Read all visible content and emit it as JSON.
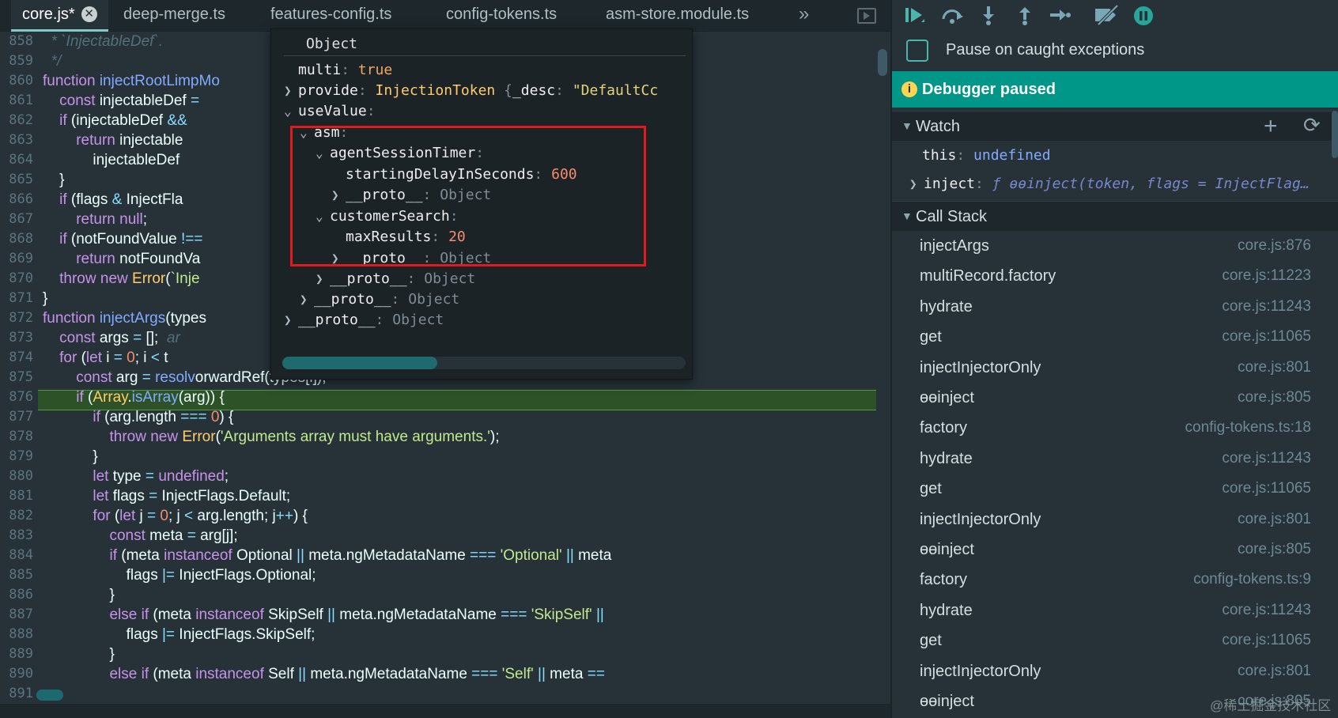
{
  "tabs": [
    {
      "label": "core.js*",
      "close": "✕"
    },
    {
      "label": "deep-merge.ts"
    },
    {
      "label": "features-config.ts"
    },
    {
      "label": "config-tokens.ts"
    },
    {
      "label": "asm-store.module.ts"
    }
  ],
  "tab_overflow": "»",
  "line_numbers": [
    "858",
    "859",
    "860",
    "861",
    "862",
    "863",
    "864",
    "865",
    "866",
    "867",
    "868",
    "869",
    "870",
    "871",
    "872",
    "873",
    "874",
    "875",
    "876",
    "877",
    "878",
    "879",
    "880",
    "881",
    "882",
    "883",
    "884",
    "885",
    "886",
    "887",
    "888",
    "889",
    "890",
    "891"
  ],
  "popup": {
    "title": "Object",
    "rows": [
      {
        "key": "multi",
        "value": "true"
      },
      {
        "key": "provide",
        "type": "InjectionToken",
        "brace": "{",
        "subkey": "_desc",
        "value": "\"DefaultCc"
      },
      {
        "key": "useValue"
      },
      {
        "key": "asm"
      },
      {
        "key": "agentSessionTimer"
      },
      {
        "key": "startingDelayInSeconds",
        "value": "600"
      },
      {
        "key": "__proto__",
        "value": "Object"
      },
      {
        "key": "customerSearch"
      },
      {
        "key": "maxResults",
        "value": "20"
      },
      {
        "key": "__proto__",
        "value": "Object"
      },
      {
        "key": "__proto__",
        "value": "Object"
      },
      {
        "key": "__proto__",
        "value": "Object"
      },
      {
        "key": "__proto__",
        "value": "Object"
      }
    ]
  },
  "debugger": {
    "pause_on_caught_label": "Pause on caught exceptions",
    "paused_label": "Debugger paused",
    "paused_icon": "i",
    "watch_title": "Watch",
    "watch": [
      {
        "name": "this",
        "value": "undefined"
      },
      {
        "name": "inject",
        "value": "ƒ ɵɵinject(token, flags = InjectFlag…"
      }
    ],
    "callstack_title": "Call Stack",
    "callstack": [
      {
        "fn": "injectArgs",
        "loc": "core.js:876"
      },
      {
        "fn": "multiRecord.factory",
        "loc": "core.js:11223"
      },
      {
        "fn": "hydrate",
        "loc": "core.js:11243"
      },
      {
        "fn": "get",
        "loc": "core.js:11065"
      },
      {
        "fn": "injectInjectorOnly",
        "loc": "core.js:801"
      },
      {
        "fn": "ɵɵinject",
        "loc": "core.js:805"
      },
      {
        "fn": "factory",
        "loc": "config-tokens.ts:18"
      },
      {
        "fn": "hydrate",
        "loc": "core.js:11243"
      },
      {
        "fn": "get",
        "loc": "core.js:11065"
      },
      {
        "fn": "injectInjectorOnly",
        "loc": "core.js:801"
      },
      {
        "fn": "ɵɵinject",
        "loc": "core.js:805"
      },
      {
        "fn": "factory",
        "loc": "config-tokens.ts:9"
      },
      {
        "fn": "hydrate",
        "loc": "core.js:11243"
      },
      {
        "fn": "get",
        "loc": "core.js:11065"
      },
      {
        "fn": "injectInjectorOnly",
        "loc": "core.js:801"
      },
      {
        "fn": "ɵɵinject",
        "loc": "core.js:805"
      }
    ]
  },
  "watermark": "@稀土掘金技术社区"
}
